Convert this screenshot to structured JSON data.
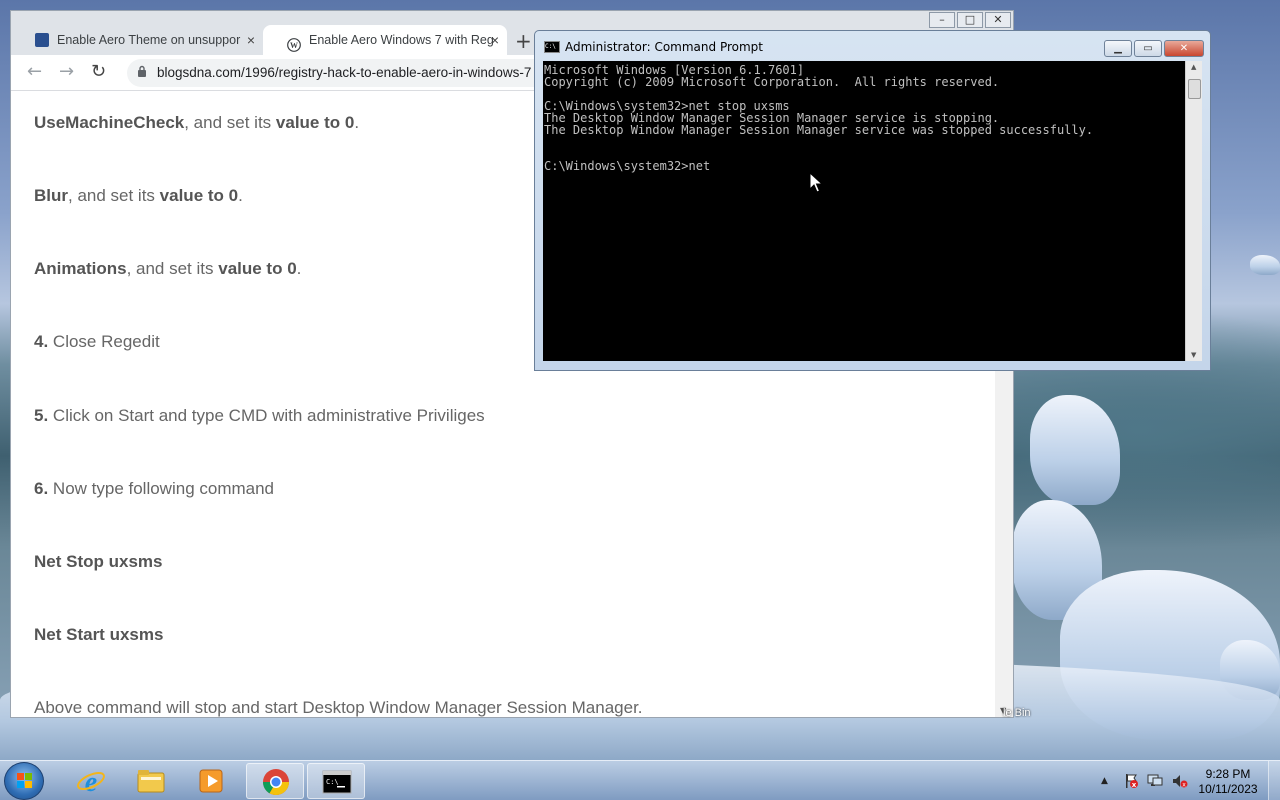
{
  "browser": {
    "tabs": [
      {
        "label": "Enable Aero Theme on unsuppor",
        "close": "×"
      },
      {
        "label": "Enable Aero Windows 7 with Reg",
        "close": "×"
      }
    ],
    "new_tab": "+",
    "window_buttons": {
      "minimize": "–",
      "maximize": "□",
      "close": "✕"
    },
    "nav": {
      "back": "←",
      "forward": "→",
      "reload": "↻"
    },
    "url": "blogsdna.com/1996/registry-hack-to-enable-aero-in-windows-7",
    "content": {
      "p1_bold": "UseMachineCheck",
      "p1_mid": ", and set its ",
      "p1_bold2": "value to 0",
      "p1_end": ".",
      "p2_bold": "Blur",
      "p2_mid": ", and set its ",
      "p2_bold2": "value to 0",
      "p2_end": ".",
      "p3_bold": "Animations",
      "p3_mid": ", and set its ",
      "p3_bold2": "value to 0",
      "p3_end": ".",
      "p4_num": "4.",
      "p4_text": " Close Regedit",
      "p5_num": "5.",
      "p5_text": " Click on Start and type CMD with administrative Priviliges",
      "p6_num": "6.",
      "p6_text": " Now type following command",
      "p7": "Net Stop uxsms",
      "p8": "Net Start uxsms",
      "p9": "Above command will stop and start Desktop Window Manager Session Manager."
    }
  },
  "cmd": {
    "title": "Administrator: Command Prompt",
    "icon_text": "C:\\",
    "lines": [
      "Microsoft Windows [Version 6.1.7601]",
      "Copyright (c) 2009 Microsoft Corporation.  All rights reserved.",
      "",
      "C:\\Windows\\system32>net stop uxsms",
      "The Desktop Window Manager Session Manager service is stopping.",
      "The Desktop Window Manager Session Manager service was stopped successfully.",
      "",
      "",
      "C:\\Windows\\system32>net"
    ]
  },
  "desktop": {
    "recycle_bin_label": "le Bin"
  },
  "taskbar": {
    "pinned": [
      "internet-explorer-icon",
      "file-explorer-icon",
      "media-player-icon",
      "chrome-icon",
      "command-prompt-icon"
    ],
    "tray_arrow": "▲",
    "clock_time": "9:28 PM",
    "clock_date": "10/11/2023"
  }
}
